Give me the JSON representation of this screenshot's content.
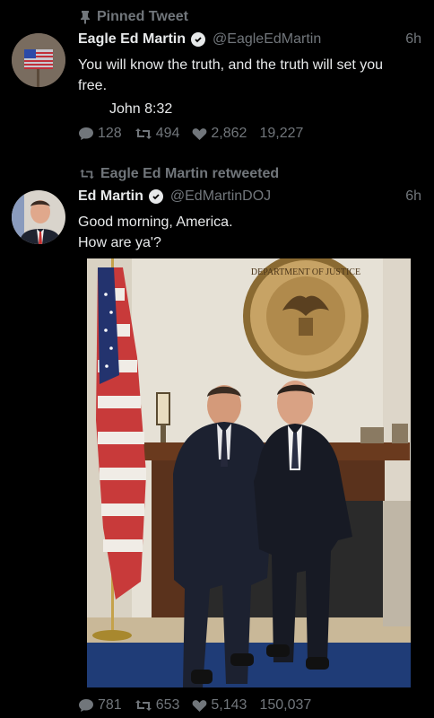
{
  "pinned": {
    "context_label": "Pinned Tweet",
    "author_name": "Eagle Ed Martin",
    "handle": "@EagleEdMartin",
    "time": "6h",
    "text_line1": "You will know the truth, and the truth will set you",
    "text_line2": "free.",
    "text_line3": "John 8:32",
    "replies": "128",
    "retweets": "494",
    "likes": "2,862",
    "views": "19,227"
  },
  "retweet": {
    "context_label": "Eagle Ed Martin retweeted",
    "author_name": "Ed Martin",
    "handle": "@EdMartinDOJ",
    "time": "6h",
    "text_line1": "Good morning, America.",
    "text_line2": "How are ya'?",
    "seal_text": "DEPARTMENT OF JUSTICE",
    "replies": "781",
    "retweets": "653",
    "likes": "5,143",
    "views": "150,037"
  },
  "colors": {
    "muted": "#71767b",
    "text": "#e7e9ea",
    "background": "#000000"
  }
}
